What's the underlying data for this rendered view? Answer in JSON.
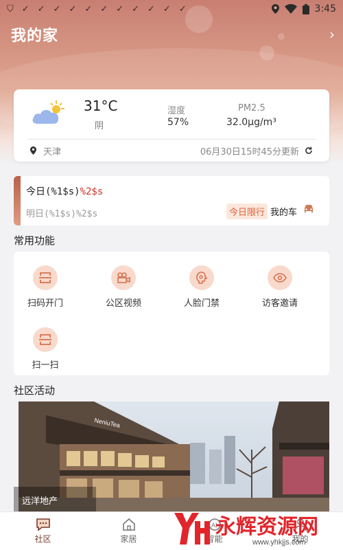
{
  "status_bar": {
    "time": "3:45"
  },
  "header": {
    "title": "我的家",
    "arrow": "›"
  },
  "weather": {
    "temperature": "31°C",
    "description": "阴",
    "humidity_label": "湿度",
    "humidity_value": "57%",
    "pm_label": "PM2.5",
    "pm_value": "32.0μg/m³",
    "location": "天津",
    "updated": "06月30日15时45分更新"
  },
  "notice": {
    "today_prefix": "今日(%1$s)",
    "today_red": "%2$s",
    "tomorrow": "明日(%1$s)%2$s",
    "limit_badge": "今日限行",
    "my_car": "我的车"
  },
  "sections": {
    "functions": "常用功能",
    "community": "社区活动"
  },
  "functions": [
    {
      "label": "扫码开门"
    },
    {
      "label": "公区视频"
    },
    {
      "label": "人脸门禁"
    },
    {
      "label": "访客邀请"
    },
    {
      "label": "扫一扫"
    }
  ],
  "banner": {
    "caption": "远洋地产",
    "sign": "NeniuTea"
  },
  "bottom_nav": [
    {
      "label": "社区"
    },
    {
      "label": "家居"
    },
    {
      "label": "智能"
    },
    {
      "label": "我的"
    }
  ],
  "watermark": {
    "text": "永辉资源网",
    "url": "www.yhkjjs.com"
  },
  "colors": {
    "accent": "#c87f72",
    "icon_bg": "#f8d9cc",
    "red": "#d0302a"
  }
}
